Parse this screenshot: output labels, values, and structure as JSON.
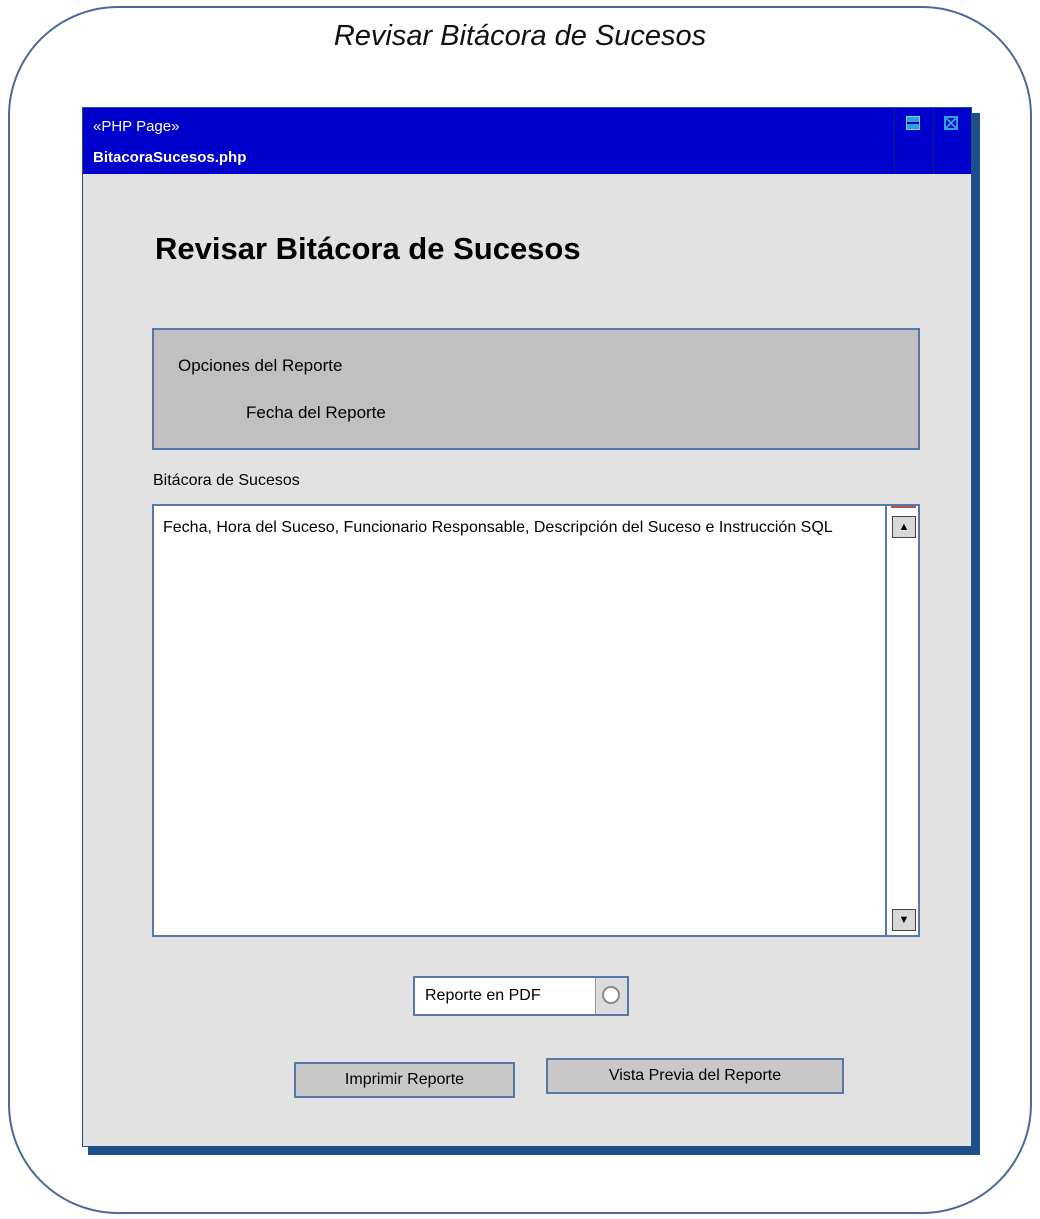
{
  "frame": {
    "title": "Revisar Bitácora de Sucesos"
  },
  "window": {
    "stereotype": "«PHP Page»",
    "page_name": "BitacoraSucesos.php"
  },
  "page": {
    "heading": "Revisar Bitácora de Sucesos"
  },
  "options": {
    "title": "Opciones del Reporte",
    "date_label": "Fecha del Reporte"
  },
  "log": {
    "label": "Bitácora de Sucesos",
    "text": "Fecha, Hora del Suceso, Funcionario Responsable, Descripción del Suceso e Instrucción SQL"
  },
  "pdf": {
    "label": "Reporte en PDF",
    "selected": false
  },
  "buttons": {
    "print": "Imprimir Reporte",
    "preview": "Vista Previa del Reporte"
  },
  "icons": {
    "minimize": "minimize-icon",
    "maximize": "maximize-icon",
    "scroll_up": "scroll-up-arrow-icon",
    "scroll_down": "scroll-down-arrow-icon"
  },
  "colors": {
    "titlebar": "#0000cc",
    "border": "#5578a8",
    "window_bg": "#e2e2e2",
    "panel_bg": "#c0c0c0"
  }
}
